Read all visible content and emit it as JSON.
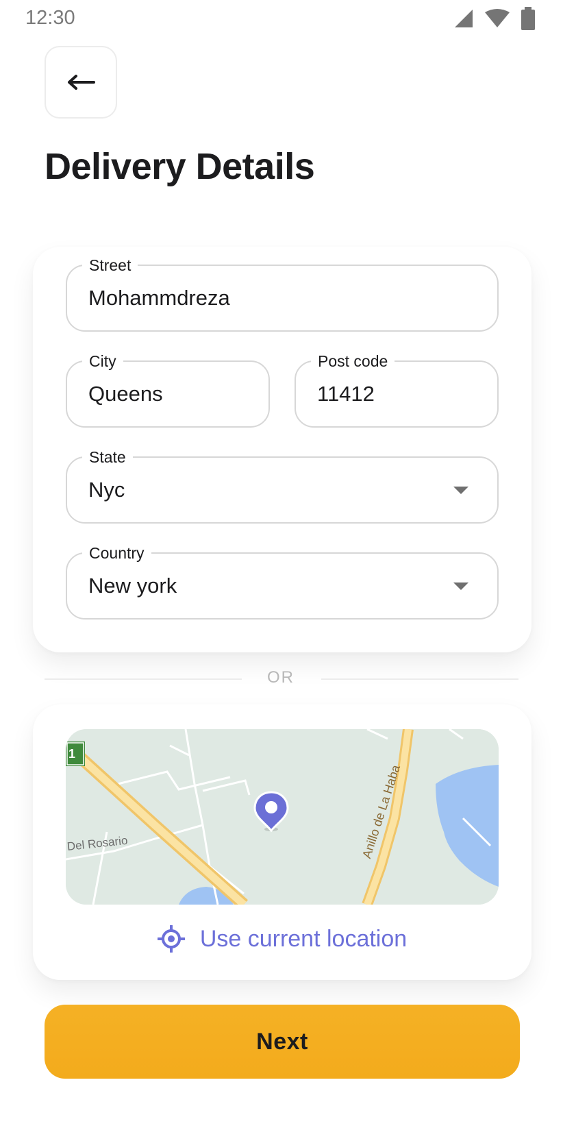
{
  "status_bar": {
    "time": "12:30"
  },
  "header": {
    "title": "Delivery Details"
  },
  "form": {
    "street": {
      "label": "Street",
      "value": "Mohammdreza"
    },
    "city": {
      "label": "City",
      "value": "Queens"
    },
    "post_code": {
      "label": "Post code",
      "value": "11412"
    },
    "state": {
      "label": "State",
      "value": "Nyc"
    },
    "country": {
      "label": "Country",
      "value": "New york"
    }
  },
  "divider": {
    "text": "OR"
  },
  "map": {
    "road_label_1": "Del Rosario",
    "road_label_2": "Anillo de La Haba",
    "highway_badge": "1"
  },
  "location_button": {
    "label": "Use current location",
    "icon": "crosshair-icon"
  },
  "next_button": {
    "label": "Next"
  },
  "colors": {
    "accent": "#6c70d9",
    "primary_button": "#f5b125",
    "map_pin": "#6b6fd6"
  }
}
